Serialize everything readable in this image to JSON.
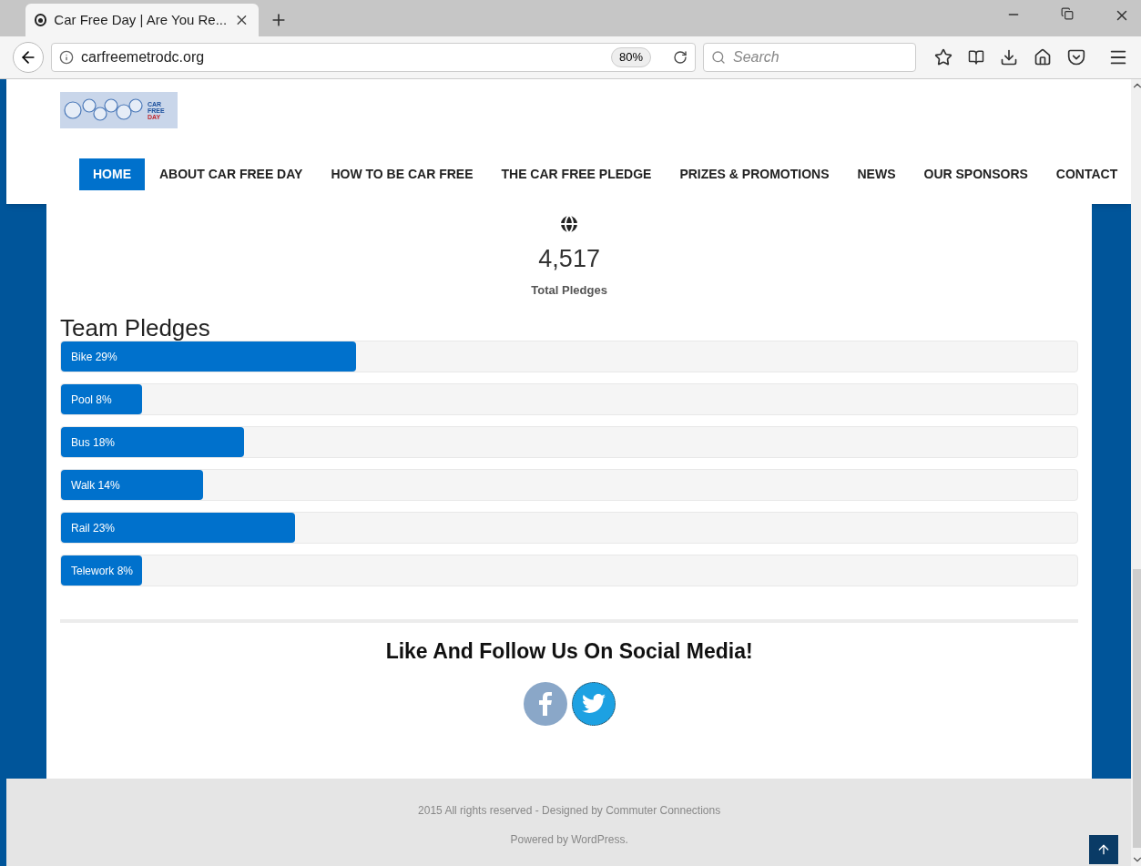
{
  "browser": {
    "tab_title": "Car Free Day | Are You Re...",
    "url": "carfreemetrodc.org",
    "zoom": "80%",
    "search_placeholder": "Search"
  },
  "logo": {
    "lines": [
      "CAR",
      "FREE",
      "DAY"
    ]
  },
  "nav": [
    {
      "label": "HOME",
      "selected": true
    },
    {
      "label": "ABOUT CAR FREE DAY",
      "selected": false
    },
    {
      "label": "HOW TO BE CAR FREE",
      "selected": false
    },
    {
      "label": "THE CAR FREE PLEDGE",
      "selected": false
    },
    {
      "label": "PRIZES & PROMOTIONS",
      "selected": false
    },
    {
      "label": "NEWS",
      "selected": false
    },
    {
      "label": "OUR SPONSORS",
      "selected": false
    },
    {
      "label": "CONTACT",
      "selected": false
    }
  ],
  "total": {
    "value": "4,517",
    "label": "Total Pledges"
  },
  "team": {
    "title": "Team Pledges",
    "bars": [
      {
        "label": "Bike 29%",
        "level": 0.29
      },
      {
        "label": "Pool 8%",
        "level": 0.08
      },
      {
        "label": "Bus 18%",
        "level": 0.18
      },
      {
        "label": "Walk 14%",
        "level": 0.14
      },
      {
        "label": "Rail 23%",
        "level": 0.23
      },
      {
        "label": "Telework 8%",
        "level": 0.08
      }
    ]
  },
  "social": {
    "title": "Like And Follow Us On Social Media!"
  },
  "footer": {
    "lines": [
      "2015 All rights reserved - Designed by Commuter Connections",
      "Powered by WordPress."
    ]
  }
}
